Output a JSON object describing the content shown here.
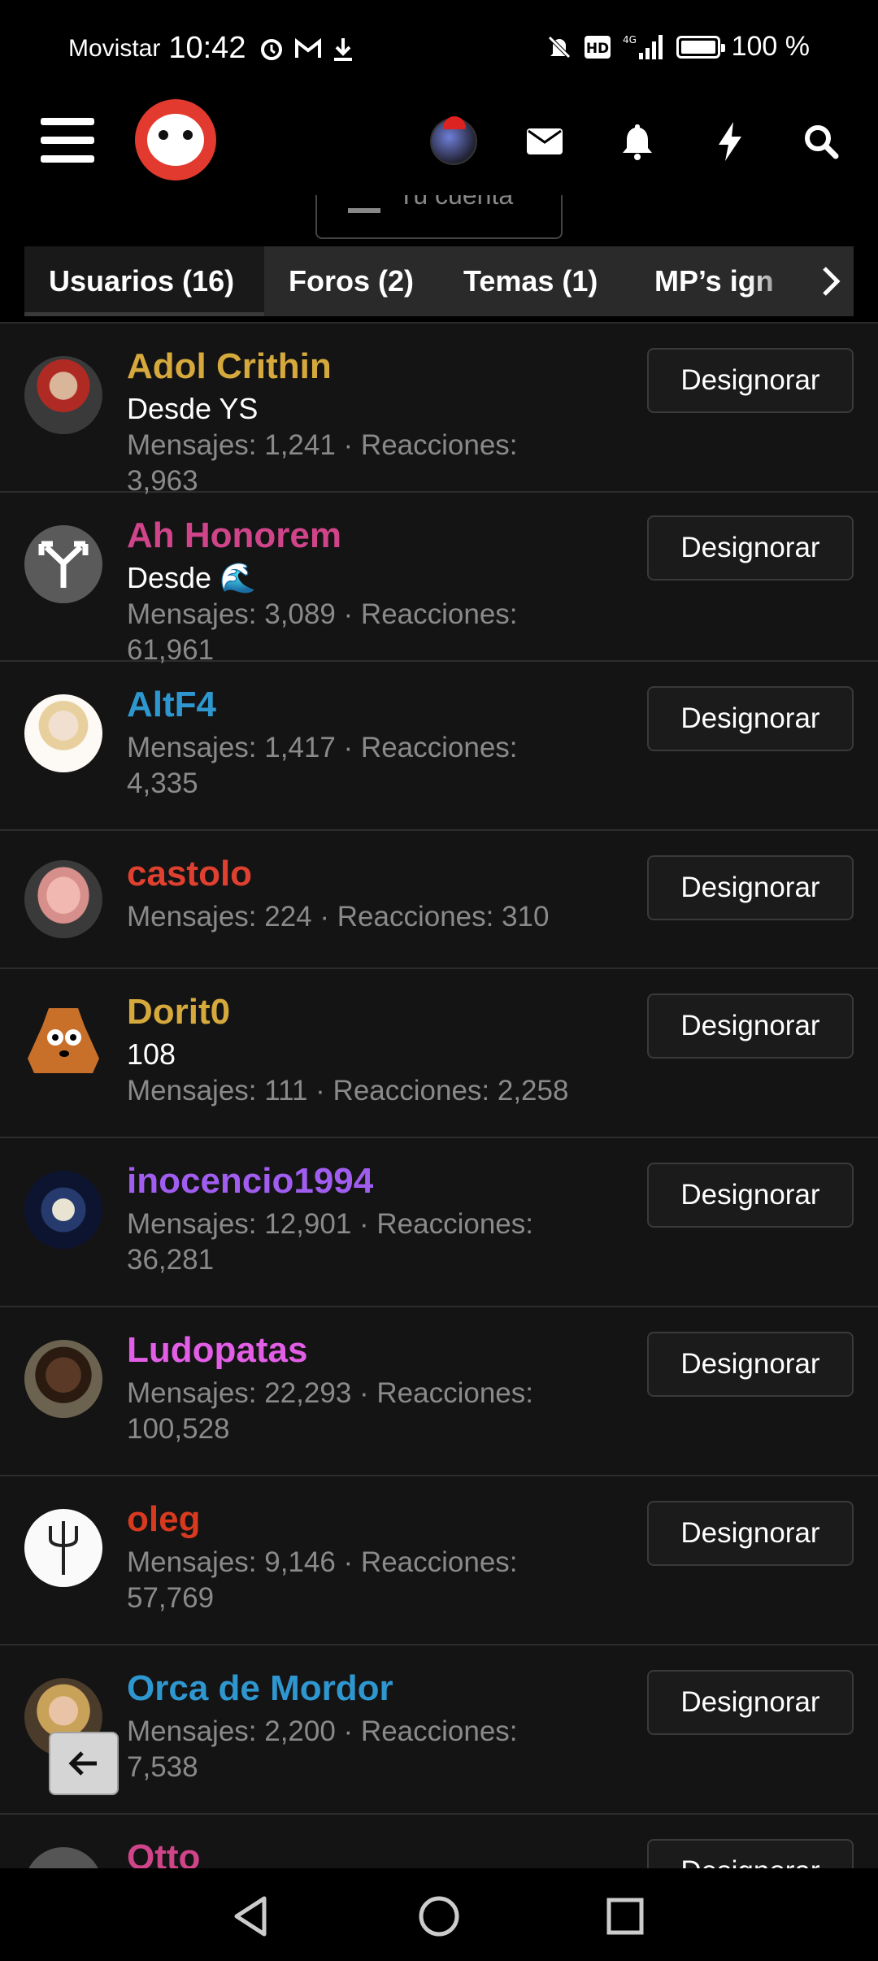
{
  "status_bar": {
    "carrier": "Movistar",
    "time": "10:42",
    "battery_text": "100 %",
    "battery_level": 1.0,
    "icons": [
      "alarm-icon",
      "gmail-icon",
      "download-icon",
      "mute-icon",
      "hd-icon",
      "signal-4g-icon",
      "battery-icon"
    ]
  },
  "header": {
    "account_tab_label": "Tu cuenta",
    "icons": [
      "menu-icon",
      "site-logo",
      "user-avatar",
      "mail-icon",
      "bell-icon",
      "bolt-icon",
      "search-icon"
    ]
  },
  "tabs": [
    {
      "label": "Usuarios (16)",
      "active": true
    },
    {
      "label": "Foros (2)",
      "active": false
    },
    {
      "label": "Temas (1)",
      "active": false
    },
    {
      "label": "MP’s ign",
      "active": false
    }
  ],
  "users": [
    {
      "name": "Adol Crithin",
      "name_color": "#d6a93d",
      "title": "Desde YS",
      "stats": "Mensajes: 1,241 · Reacciones: 3,963",
      "button": "Designorar"
    },
    {
      "name": "Ah Honorem",
      "name_color": "#d0458a",
      "title": "Desde 🌊",
      "stats": "Mensajes: 3,089 · Reacciones: 61,961",
      "button": "Designorar"
    },
    {
      "name": "AltF4",
      "name_color": "#2f97d0",
      "title": "",
      "stats": "Mensajes: 1,417 · Reacciones: 4,335",
      "button": "Designorar"
    },
    {
      "name": "castolo",
      "name_color": "#e0402f",
      "title": "",
      "stats": "Mensajes: 224 · Reacciones: 310",
      "button": "Designorar"
    },
    {
      "name": "Dorit0",
      "name_color": "#d6a93d",
      "title": "108",
      "stats": "Mensajes: 111 · Reacciones: 2,258",
      "button": "Designorar"
    },
    {
      "name": "inocencio1994",
      "name_color": "#a05df0",
      "title": "",
      "stats": "Mensajes: 12,901 · Reacciones: 36,281",
      "button": "Designorar"
    },
    {
      "name": "Ludopatas",
      "name_color": "#e35ee6",
      "title": "",
      "stats": "Mensajes: 22,293 · Reacciones: 100,528",
      "button": "Designorar"
    },
    {
      "name": "oleg",
      "name_color": "#d83a1f",
      "title": "",
      "stats": "Mensajes: 9,146 · Reacciones: 57,769",
      "button": "Designorar"
    },
    {
      "name": "Orca de Mordor",
      "name_color": "#2f97d0",
      "title": "",
      "stats": "Mensajes: 2,200 · Reacciones: 7,538",
      "button": "Designorar"
    },
    {
      "name": "Otto",
      "name_color": "#d0458a",
      "title": "",
      "stats": "",
      "button": "Designorar"
    }
  ]
}
